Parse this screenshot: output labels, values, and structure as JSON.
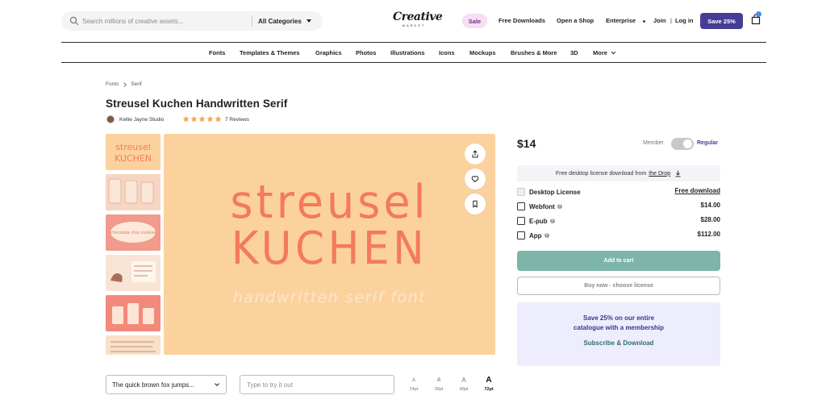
{
  "header": {
    "search_placeholder": "Search millions of creative assets...",
    "category_select": "All Categories",
    "logo_main": "Creative",
    "logo_sub": "MARKET",
    "sale": "Sale",
    "free_downloads": "Free Downloads",
    "open_shop": "Open a Shop",
    "enterprise": "Enterprise",
    "join": "Join",
    "separator": "|",
    "login": "Log in",
    "save_button": "Save 25%"
  },
  "category_nav": [
    "Fonts",
    "Templates & Themes",
    "Graphics",
    "Photos",
    "Illustrations",
    "Icons",
    "Mockups",
    "Brushes & More",
    "3D",
    "More"
  ],
  "breadcrumb": [
    "Fonts",
    "Serif"
  ],
  "product": {
    "title": "Streusel Kuchen Handwritten Serif",
    "shop": "Kellie Jayne Studio",
    "rating": 5,
    "reviews": "7 Reviews",
    "art_line1": "streusel",
    "art_line2": "KUCHEN",
    "art_line3": "handwritten serif font"
  },
  "thumbnails": [
    {
      "text": "streusel\nKUCHEN",
      "bg": "#fbd29e",
      "fg": "#f47a5a"
    },
    {
      "text": "",
      "bg": "#f6d6c3",
      "fg": "#e9a38d"
    },
    {
      "text": "chocolate chip cookies",
      "bg": "#f29a8c",
      "fg": "#ffffff"
    },
    {
      "text": "",
      "bg": "#f8e4d4",
      "fg": "#a96e5a"
    },
    {
      "text": "",
      "bg": "#f3897b",
      "fg": "#ffffff"
    },
    {
      "text": "",
      "bg": "#f8e0c9",
      "fg": "#c88a6e"
    }
  ],
  "tester": {
    "sample_text": "The quick brown fox jumps...",
    "input_placeholder": "Type to try it out",
    "sizes": [
      {
        "glyph": "A",
        "label": "24pt"
      },
      {
        "glyph": "A",
        "label": "36pt"
      },
      {
        "glyph": "A",
        "label": "48pt"
      },
      {
        "glyph": "A",
        "label": "72pt"
      }
    ],
    "active_size": "72pt"
  },
  "purchase": {
    "price": "$14",
    "member_label": "Member",
    "regular_label": "Regular",
    "drop_banner": "Free desktop license download from",
    "drop_link": "the Drop",
    "licenses": [
      {
        "name": "Desktop License",
        "price": "Free download",
        "info": false,
        "free": true
      },
      {
        "name": "Webfont",
        "price": "$14.00",
        "info": true,
        "free": false
      },
      {
        "name": "E-pub",
        "price": "$28.00",
        "info": true,
        "free": false
      },
      {
        "name": "App",
        "price": "$112.00",
        "info": true,
        "free": false
      }
    ],
    "add_to_cart": "Add to cart",
    "buy_now": "Buy now - choose license"
  },
  "promo": {
    "line1": "Save 25% on our entire",
    "line2": "catalogue with a membership",
    "link": "Subscribe & Download"
  },
  "colors": {
    "brand_purple": "#463d96",
    "teal_button": "#7eb5ab",
    "hero_bg": "#fbd29e",
    "hero_text": "#f47a5a",
    "promo_bg": "#eeedfd"
  }
}
